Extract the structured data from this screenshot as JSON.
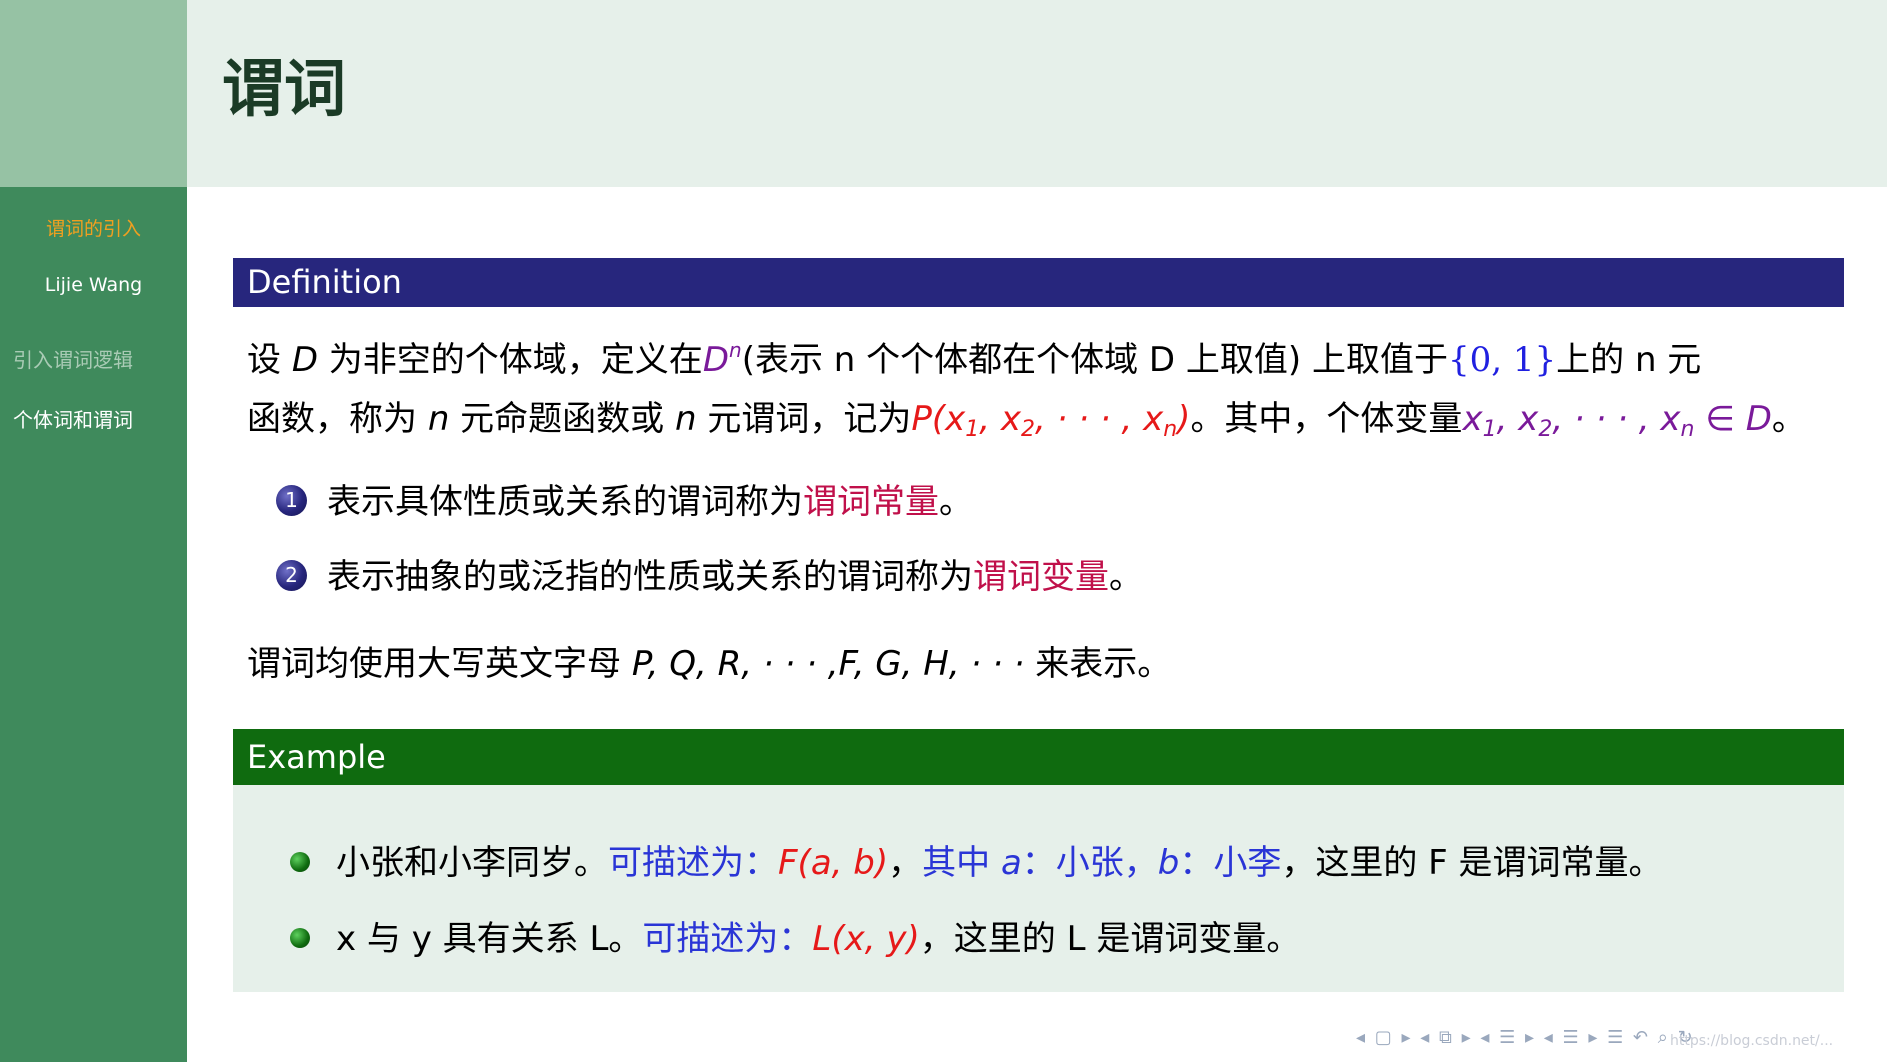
{
  "sidebar": {
    "section": "谓词的引入",
    "author": "Lijie Wang",
    "items": [
      {
        "label": "引入谓词逻辑",
        "active": false
      },
      {
        "label": "个体词和谓词",
        "active": true
      }
    ]
  },
  "header": {
    "title": "谓词"
  },
  "definition": {
    "heading": "Definition",
    "line1": {
      "a": "设 ",
      "D": "D",
      "b": " 为非空的个体域，定义在",
      "Dn": "D",
      "n": "n",
      "c": "(表示 n 个个体都在个体域 D 上取值) 上取值于",
      "set": "{0, 1}",
      "d": "上的 n 元"
    },
    "line2": {
      "a": "函数，称为 ",
      "n1": "n",
      "b": " 元命题函数或 ",
      "n2": "n",
      "c": " 元谓词，记为",
      "P": "P(x",
      "P_sub1": "1",
      "P_mid": ", x",
      "P_sub2": "2",
      "P_mid2": ", · · · , x",
      "P_subn": "n",
      "P_end": ")",
      "d": "。其中，个体变量",
      "X": "x",
      "X_sub1": "1",
      "X_mid": ", x",
      "X_sub2": "2",
      "X_mid2": ", · · · , x",
      "X_subn": "n",
      "X_in": " ∈ D",
      "e": "。"
    },
    "enum": [
      {
        "num": "1",
        "text": "表示具体性质或关系的谓词称为",
        "term": "谓词常量",
        "end": "。"
      },
      {
        "num": "2",
        "text": "表示抽象的或泛指的性质或关系的谓词称为",
        "term": "谓词变量",
        "end": "。"
      }
    ],
    "note": {
      "a": "谓词均使用大写英文字母 ",
      "letters": "P, Q, R, · · · ,F, G, H, · · · ",
      "b": " 来表示。"
    }
  },
  "example": {
    "heading": "Example",
    "items": [
      {
        "a": "小张和小李同岁。",
        "desc": "可描述为：",
        "expr": "F(a, b)",
        "b": "，",
        "c": "其中 ",
        "va": "a",
        "d": "：小张，",
        "vb": "b",
        "e": "：小李",
        "f": "，这里的 F 是谓词常量。"
      },
      {
        "a": "x 与 y 具有关系 L。",
        "desc": "可描述为：",
        "expr": "L(x, y)",
        "f": "，这里的 L 是谓词变量。"
      }
    ]
  },
  "nav": {
    "symbols": "◂ ▢ ▸  ◂ ⧉ ▸  ◂ ☰ ▸  ◂ ☰ ▸   ☰   ↶ ⌕ ↻",
    "watermark": "https://blog.csdn.net/..."
  }
}
